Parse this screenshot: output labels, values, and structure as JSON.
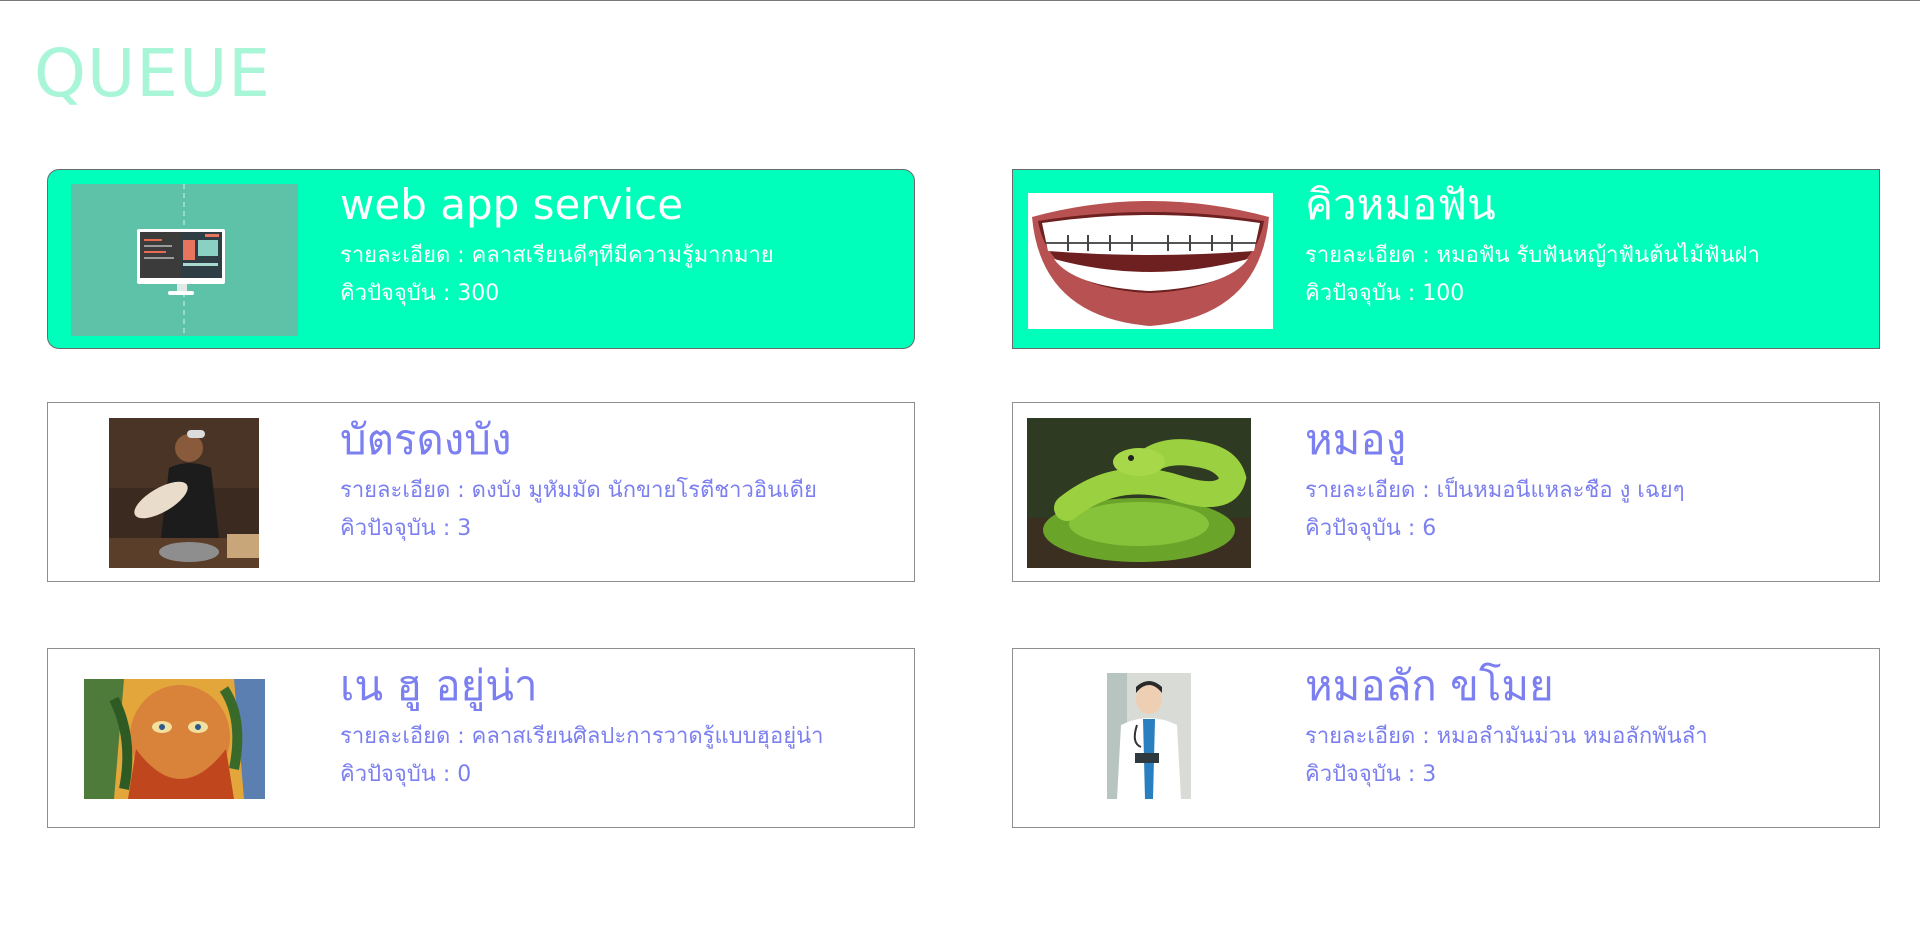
{
  "page": {
    "title": "QUEUE"
  },
  "labels": {
    "detail_prefix": "รายละเอียด : ",
    "queue_prefix": "คิวปัจจุบัน : "
  },
  "cards": [
    {
      "name": "web app service",
      "detail": "รายละเอียด : คลาสเรียนดีๆทีมีความรู้มากมาย",
      "queue": "คิวปัจจุบัน : 300",
      "highlighted": true,
      "image_icon": "computer-monitor-illustration"
    },
    {
      "name": "คิวหมอฟัน",
      "detail": "รายละเอียด : หมอฟัน รับฟันหญ้าฟันต้นไม้ฟันฝา",
      "queue": "คิวปัจจุบัน : 100",
      "highlighted": true,
      "image_icon": "smile-braces-illustration"
    },
    {
      "name": "บัตรดงบัง",
      "detail": "รายละเอียด : ดงบัง มูหัมมัด นักขายโรตีชาวอินเดีย",
      "queue": "คิวปัจจุบัน : 3",
      "highlighted": false,
      "image_icon": "roti-vendor-photo"
    },
    {
      "name": "หมองู",
      "detail": "รายละเอียด : เป็นหมอนีแหละชือ งู เฉยๆ",
      "queue": "คิวปัจจุบัน : 6",
      "highlighted": false,
      "image_icon": "green-snake-photo"
    },
    {
      "name": "เน ฮู อยู่น่า",
      "detail": "รายละเอียด : คลาสเรียนศิลปะการวาดรู้แบบฮุอยู่น่า",
      "queue": "คิวปัจจุบัน : 0",
      "highlighted": false,
      "image_icon": "painted-portrait-artwork"
    },
    {
      "name": "หมอลัก ขโมย",
      "detail": "รายละเอียด : หมอลำมันม่วน หมอลักพันลำ",
      "queue": "คิวปัจจุบัน : 3",
      "highlighted": false,
      "image_icon": "doctor-portrait-photo"
    }
  ],
  "colors": {
    "title": "#a8f5d8",
    "highlight_bg": "#00ffbb",
    "text_purple": "#7b7ff0"
  }
}
